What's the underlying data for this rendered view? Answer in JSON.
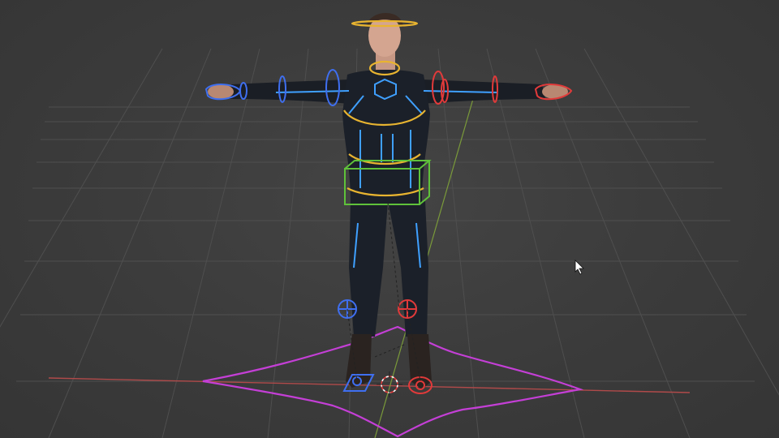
{
  "viewport": {
    "background": "#3d3d3d",
    "grid_color": "#4f4f4f",
    "x_axis_color": "#b04a4a",
    "y_axis_color": "#7a9a3a"
  },
  "rig": {
    "left_side_control_color": "#3f6ff0",
    "right_side_control_color": "#e23a3a",
    "torso_control_color": "#e8b430",
    "hip_box_color": "#5fc23a",
    "root_control_color": "#c43fd6",
    "suit_accent_color": "#3fa0ff"
  },
  "icons": {
    "cursor": "mouse-pointer-icon",
    "cursor_3d": "3d-cursor-icon"
  }
}
